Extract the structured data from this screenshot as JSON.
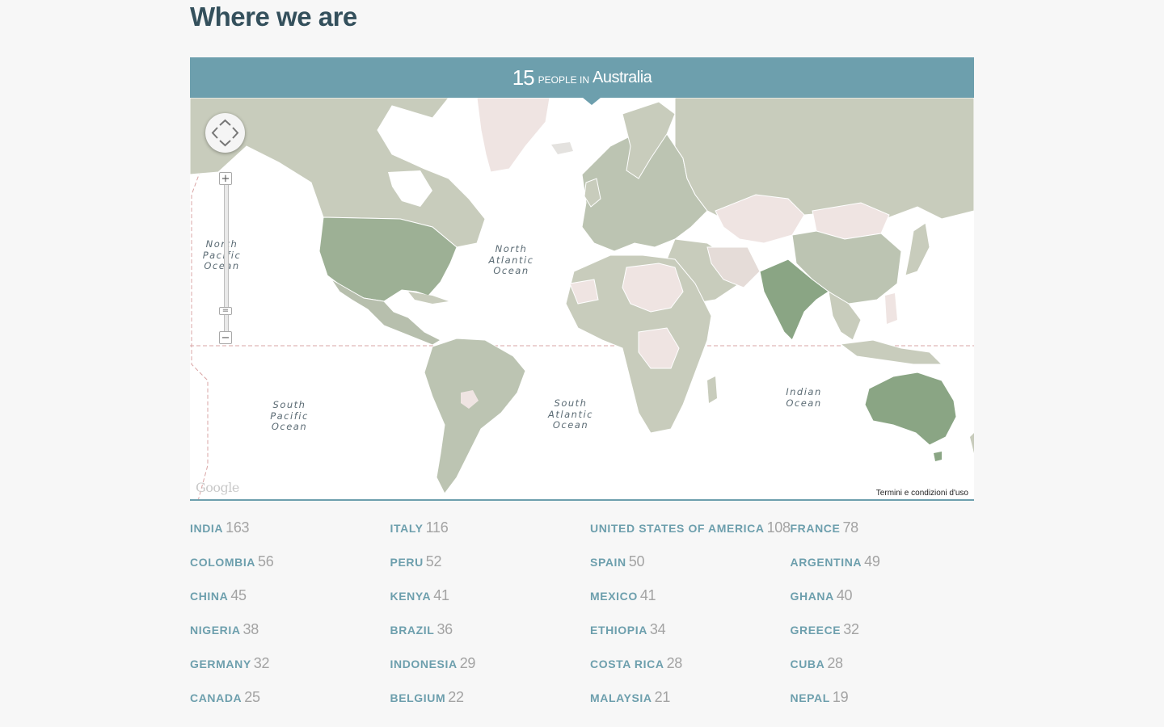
{
  "page": {
    "title": "Where we are"
  },
  "banner": {
    "count": "15",
    "mid": "people in",
    "country": "Australia"
  },
  "map": {
    "highlight_color": "#8aa584",
    "land_color": "#c8ccbc",
    "pink_color": "#efe4e2",
    "oceans": {
      "north_pacific": "North Pacific Ocean",
      "north_atlantic": "North Atlantic Ocean",
      "south_pacific": "South Pacific Ocean",
      "south_atlantic": "South Atlantic Ocean",
      "indian": "Indian Ocean"
    },
    "google_logo": "Google",
    "terms": "Termini e condizioni d'uso",
    "zoom_in": "+",
    "zoom_handle": "=",
    "zoom_out": "−"
  },
  "stats": [
    {
      "name": "India",
      "count": "163"
    },
    {
      "name": "Italy",
      "count": "116"
    },
    {
      "name": "United States of America",
      "count": "108"
    },
    {
      "name": "France",
      "count": "78"
    },
    {
      "name": "Colombia",
      "count": "56"
    },
    {
      "name": "Peru",
      "count": "52"
    },
    {
      "name": "Spain",
      "count": "50"
    },
    {
      "name": "Argentina",
      "count": "49"
    },
    {
      "name": "China",
      "count": "45"
    },
    {
      "name": "Kenya",
      "count": "41"
    },
    {
      "name": "Mexico",
      "count": "41"
    },
    {
      "name": "Ghana",
      "count": "40"
    },
    {
      "name": "Nigeria",
      "count": "38"
    },
    {
      "name": "Brazil",
      "count": "36"
    },
    {
      "name": "Ethiopia",
      "count": "34"
    },
    {
      "name": "Greece",
      "count": "32"
    },
    {
      "name": "Germany",
      "count": "32"
    },
    {
      "name": "Indonesia",
      "count": "29"
    },
    {
      "name": "Costa Rica",
      "count": "28"
    },
    {
      "name": "Cuba",
      "count": "28"
    },
    {
      "name": "Canada",
      "count": "25"
    },
    {
      "name": "Belgium",
      "count": "22"
    },
    {
      "name": "Malaysia",
      "count": "21"
    },
    {
      "name": "Nepal",
      "count": "19"
    }
  ]
}
